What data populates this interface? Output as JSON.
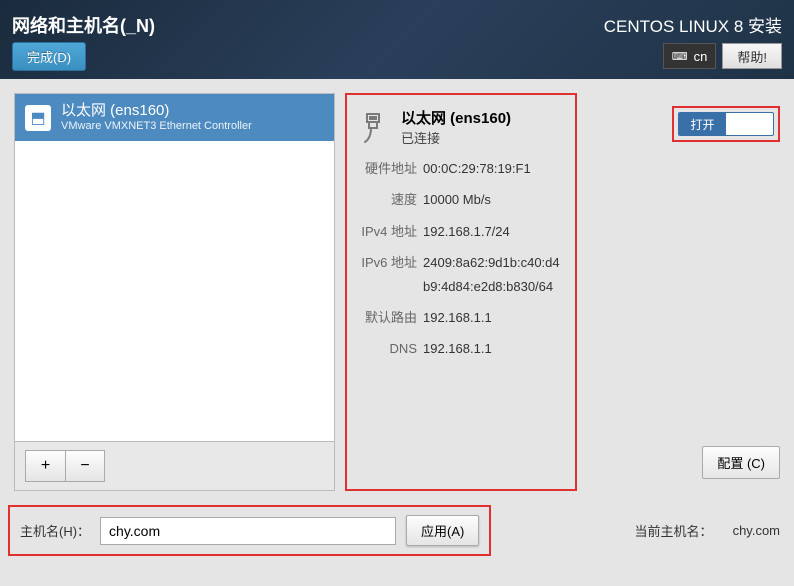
{
  "header": {
    "title": "网络和主机名(_N)",
    "done": "完成(D)",
    "product": "CENTOS LINUX 8 安装",
    "keyboard": "cn",
    "help": "帮助!"
  },
  "network_list": {
    "items": [
      {
        "name": "以太网 (ens160)",
        "subtitle": "VMware VMXNET3 Ethernet Controller"
      }
    ]
  },
  "detail": {
    "title": "以太网 (ens160)",
    "status": "已连接",
    "rows": {
      "hw_label": "硬件地址",
      "hw_value": "00:0C:29:78:19:F1",
      "speed_label": "速度",
      "speed_value": "10000 Mb/s",
      "ipv4_label": "IPv4 地址",
      "ipv4_value": "192.168.1.7/24",
      "ipv6_label": "IPv6 地址",
      "ipv6_value": "2409:8a62:9d1b:c40:d4b9:4d84:e2d8:b830/64",
      "route_label": "默认路由",
      "route_value": "192.168.1.1",
      "dns_label": "DNS",
      "dns_value": "192.168.1.1"
    }
  },
  "toggle": {
    "on_label": "打开"
  },
  "buttons": {
    "configure": "配置 (C)",
    "apply": "应用(A)"
  },
  "hostname": {
    "label": "主机名(H)：",
    "value": "chy.com",
    "current_label": "当前主机名：",
    "current_value": "chy.com"
  }
}
